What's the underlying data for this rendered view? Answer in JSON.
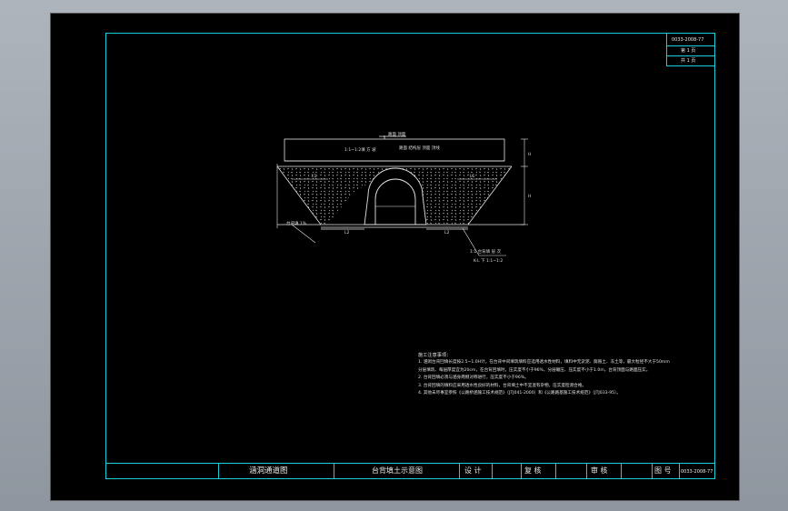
{
  "sheet_info": {
    "drawing_number": "0033-2008-77",
    "page": "第 1 页",
    "total": "共 1 页"
  },
  "title_block": {
    "project": "涵洞通道图",
    "drawing_title": "台背填土示意图",
    "design_label": "设 计",
    "review_label": "复 核",
    "audit_label": "审 核",
    "number_label": "图 号",
    "number_value": "0033-2008-77"
  },
  "drawing": {
    "top_note": "路面 顶面",
    "pave_note": "路面 结构层 顶面 顶线",
    "fill_note": "1:1~1:2填 方 坡",
    "left_dim": "L1",
    "right_dim": "L1",
    "slope_label": "台背填 1%",
    "bottom_dim_left": "L2",
    "bottom_dim_right": "L2",
    "base_note_1": "1:1  台背填 层 次",
    "base_note_2": "K-L 下 1:1~1:2",
    "height_top": "H",
    "height_bottom": "H"
  },
  "notes": {
    "heading": "施工注意事项：",
    "items": [
      "1. 涵洞台背回填长度按2.5~1.0H计，在台背中间填筑填料应选用透水性材料，填料中无淤泥、腐殖土、冻土等，最大粒径不大于50mm",
      "   分层填筑、每层厚度宜为20cm，在台背回填时，压实度不小于96%，分层碾压、压实度不小于1.0m，台背顶面与路面压实。",
      "2. 台背回填必须与涵身两侧对称进行，压实度不小于96%。",
      "3. 台背回填的填料应采用透水性良好的材料，台背填土中不宜混有杂物，压实度检测合格。",
      "4. 其他未尽事宜参照《公路桥涵施工技术规范》（JTJ041-2000）和《公路路基施工技术规范》（JTJ033-95）。"
    ]
  },
  "colors": {
    "frame": "#18d0d8",
    "lines": "#e6e6e6",
    "sheet_bg": "#000000",
    "window_bg": "#9aa0a8"
  }
}
